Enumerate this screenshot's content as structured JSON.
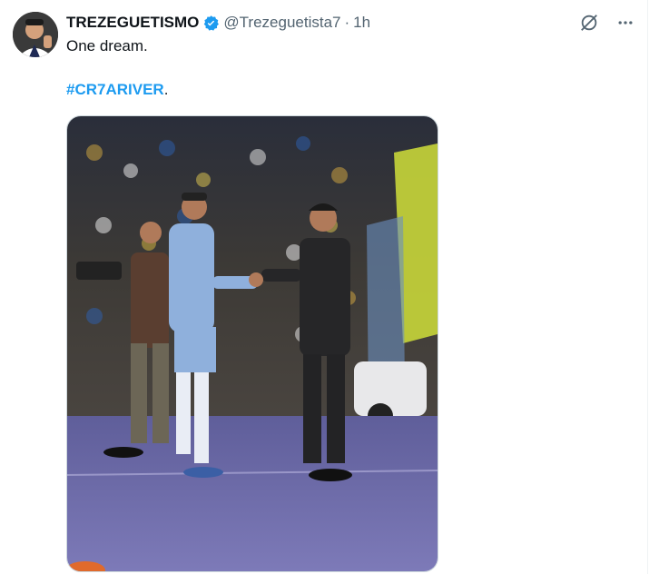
{
  "tweet": {
    "display_name": "TREZEGUETISMO",
    "handle": "@Trezeguetista7",
    "separator": "·",
    "time": "1h",
    "text": "One dream.",
    "hashtag": "#CR7ARIVER",
    "hashtag_suffix": "."
  },
  "icons": {
    "verified": "verified-badge-icon",
    "grok": "grok-icon",
    "more": "more-icon"
  },
  "colors": {
    "accent": "#1d9bf0",
    "text": "#0f1419",
    "muted": "#536471",
    "pitch": "#6f6aa8"
  }
}
